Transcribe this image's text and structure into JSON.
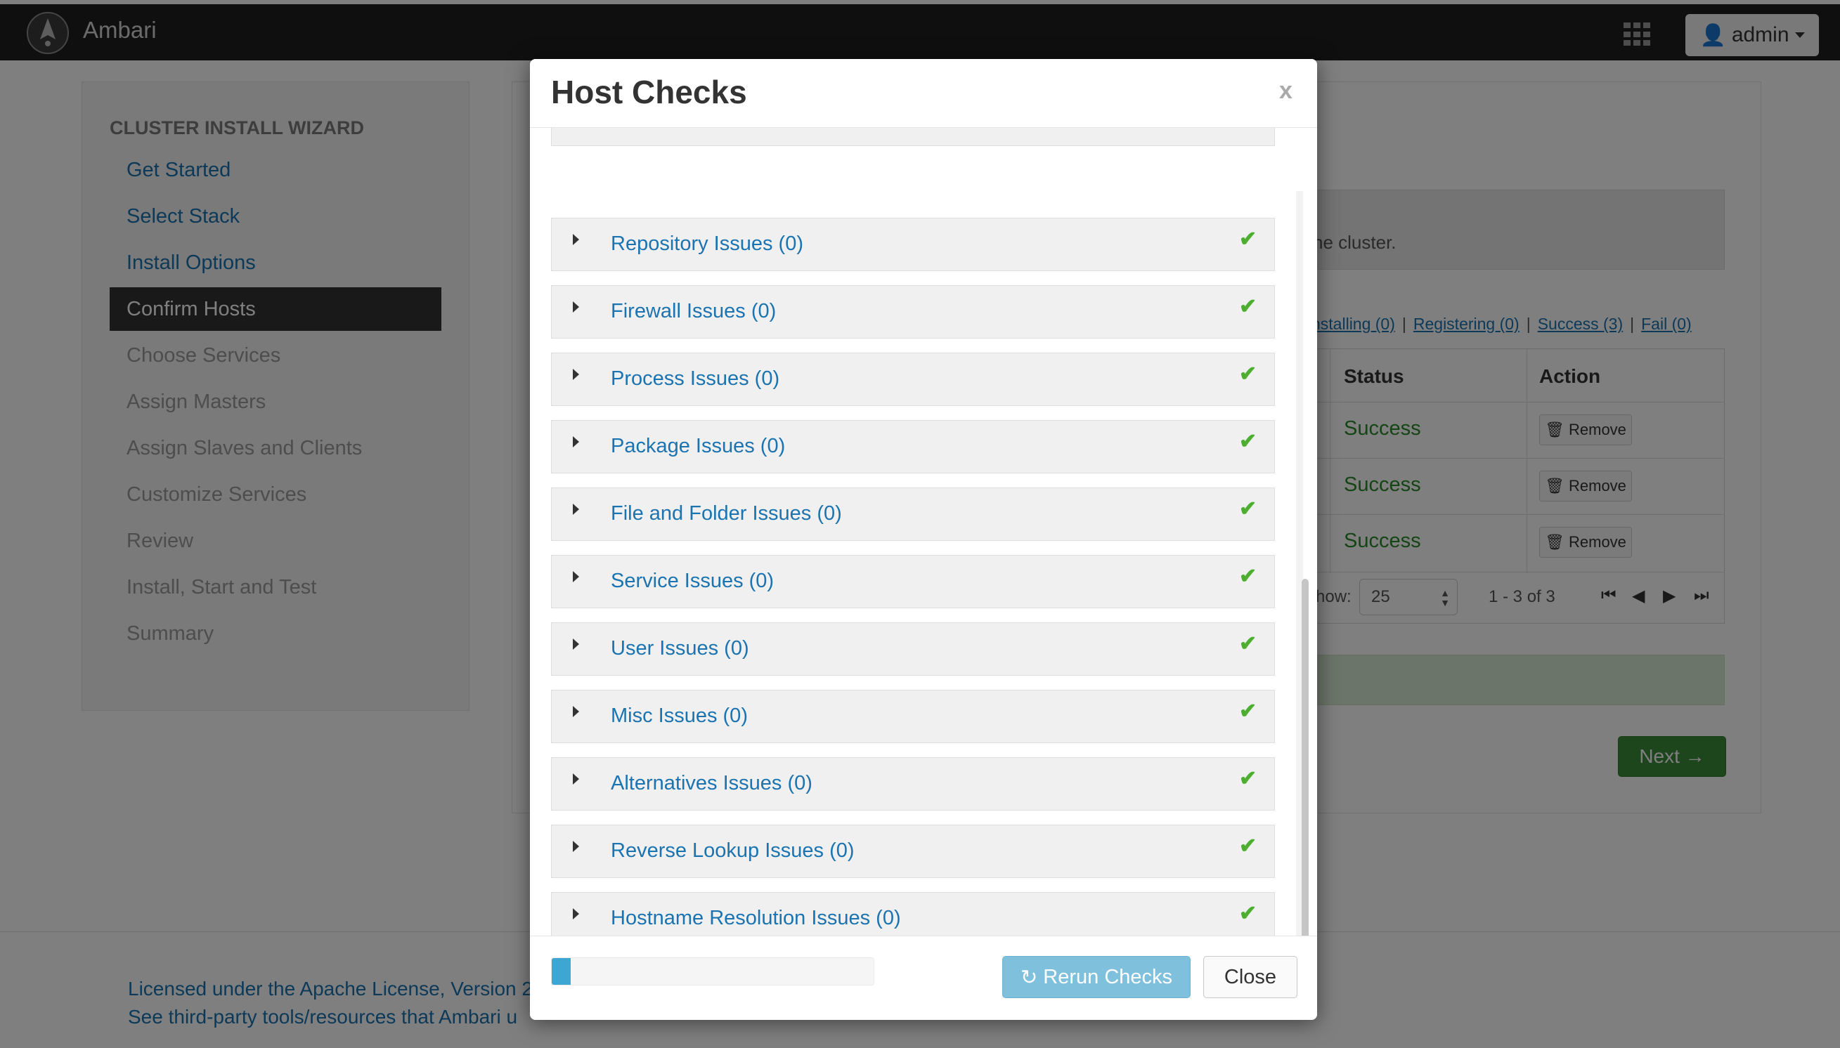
{
  "app": {
    "name": "Ambari",
    "user": "admin",
    "logo_icon": "ambari-logo-icon",
    "apps_icon": "grid-icon"
  },
  "wizard": {
    "title": "CLUSTER INSTALL WIZARD",
    "steps": [
      {
        "label": "Get Started",
        "state": "done"
      },
      {
        "label": "Select Stack",
        "state": "done"
      },
      {
        "label": "Install Options",
        "state": "done"
      },
      {
        "label": "Confirm Hosts",
        "state": "active"
      },
      {
        "label": "Choose Services",
        "state": "todo"
      },
      {
        "label": "Assign Masters",
        "state": "todo"
      },
      {
        "label": "Assign Slaves and Clients",
        "state": "todo"
      },
      {
        "label": "Customize Services",
        "state": "todo"
      },
      {
        "label": "Review",
        "state": "todo"
      },
      {
        "label": "Install, Start and Test",
        "state": "todo"
      },
      {
        "label": "Summary",
        "state": "todo"
      }
    ]
  },
  "background": {
    "alert_text": "he cluster.",
    "filters": [
      "nstalling (0)",
      "Registering (0)",
      "Success (3)",
      "Fail (0)"
    ],
    "table": {
      "columns": [
        "Status",
        "Action"
      ],
      "rows": [
        {
          "status": "Success",
          "action": "Remove"
        },
        {
          "status": "Success",
          "action": "Remove"
        },
        {
          "status": "Success",
          "action": "Remove"
        }
      ]
    },
    "pagination": {
      "show_label": "how:",
      "page_size": "25",
      "range": "1 - 3 of 3"
    },
    "next_button": "Next →",
    "footer": {
      "line1": "Licensed under the Apache License, Version 2",
      "line2": "See third-party tools/resources that Ambari u"
    }
  },
  "modal": {
    "title": "Host Checks",
    "close_x": "x",
    "checks": [
      {
        "label": "Repository Issues (0)",
        "status": "ok"
      },
      {
        "label": "Firewall Issues (0)",
        "status": "ok"
      },
      {
        "label": "Process Issues (0)",
        "status": "ok"
      },
      {
        "label": "Package Issues (0)",
        "status": "ok"
      },
      {
        "label": "File and Folder Issues (0)",
        "status": "ok"
      },
      {
        "label": "Service Issues (0)",
        "status": "ok"
      },
      {
        "label": "User Issues (0)",
        "status": "ok"
      },
      {
        "label": "Misc Issues (0)",
        "status": "ok"
      },
      {
        "label": "Alternatives Issues (0)",
        "status": "ok"
      },
      {
        "label": "Reverse Lookup Issues (0)",
        "status": "ok"
      },
      {
        "label": "Hostname Resolution Issues (0)",
        "status": "ok"
      }
    ],
    "progress_fraction": 0.06,
    "rerun_button": "Rerun Checks",
    "close_button": "Close",
    "colors": {
      "link": "#1b73b0",
      "check": "#4caf2f",
      "progress": "#3da6d3"
    }
  }
}
